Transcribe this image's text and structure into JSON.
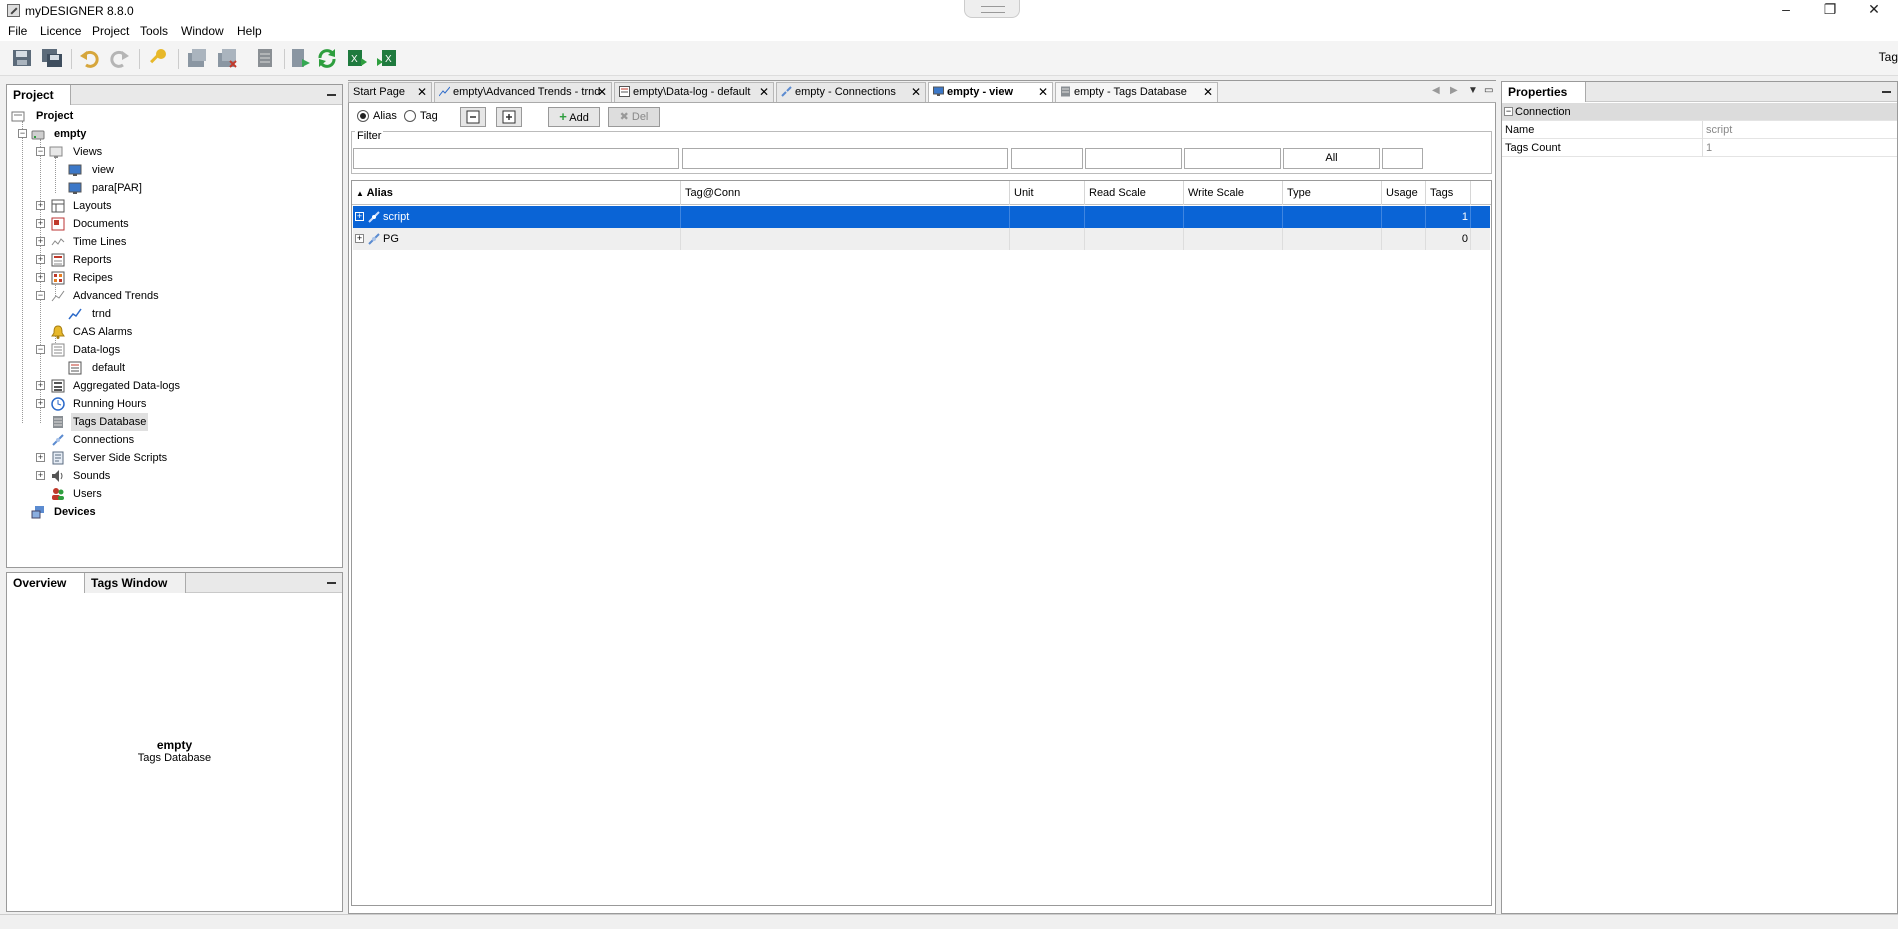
{
  "window": {
    "title": "myDESIGNER 8.8.0",
    "minimize": "–",
    "restore": "❐",
    "close": "✕"
  },
  "menu": [
    "File",
    "Licence",
    "Project",
    "Tools",
    "Window",
    "Help"
  ],
  "toolbar": {
    "right_label": "Tag"
  },
  "project_panel": {
    "title": "Project",
    "tree": [
      {
        "label": "Project",
        "icon": "project-icon",
        "bold": true
      },
      {
        "label": "empty",
        "icon": "hdd-icon",
        "bold": true
      },
      {
        "label": "Views",
        "icon": "views-icon"
      },
      {
        "label": "view",
        "icon": "monitor-icon"
      },
      {
        "label": "para[PAR]",
        "icon": "monitor-icon"
      },
      {
        "label": "Layouts",
        "icon": "layouts-icon"
      },
      {
        "label": "Documents",
        "icon": "documents-icon"
      },
      {
        "label": "Time Lines",
        "icon": "timeline-icon"
      },
      {
        "label": "Reports",
        "icon": "reports-icon"
      },
      {
        "label": "Recipes",
        "icon": "recipes-icon"
      },
      {
        "label": "Advanced Trends",
        "icon": "trend-icon"
      },
      {
        "label": "trnd",
        "icon": "trend-icon"
      },
      {
        "label": "CAS Alarms",
        "icon": "bell-icon"
      },
      {
        "label": "Data-logs",
        "icon": "datalog-icon"
      },
      {
        "label": "default",
        "icon": "datalog-icon"
      },
      {
        "label": "Aggregated Data-logs",
        "icon": "aggregated-icon"
      },
      {
        "label": "Running Hours",
        "icon": "clock-icon"
      },
      {
        "label": "Tags Database",
        "icon": "database-icon"
      },
      {
        "label": "Connections",
        "icon": "connection-icon"
      },
      {
        "label": "Server Side Scripts",
        "icon": "script-icon"
      },
      {
        "label": "Sounds",
        "icon": "speaker-icon"
      },
      {
        "label": "Users",
        "icon": "users-icon"
      },
      {
        "label": "Devices",
        "icon": "devices-icon",
        "bold": true
      }
    ]
  },
  "overview_panel": {
    "tabs": [
      "Overview",
      "Tags Window"
    ],
    "name": "empty",
    "subtitle": "Tags Database"
  },
  "doc_tabs": [
    {
      "label": "Start Page"
    },
    {
      "label": "empty\\Advanced Trends - trnd"
    },
    {
      "label": "empty\\Data-log - default"
    },
    {
      "label": "empty - Connections"
    },
    {
      "label": "empty - view"
    },
    {
      "label": "empty - Tags Database"
    }
  ],
  "tags_db": {
    "radio_alias": "Alias",
    "radio_tag": "Tag",
    "add_label": "Add",
    "del_label": "Del",
    "filter_label": "Filter",
    "filter_all": "All",
    "columns": [
      "Alias",
      "Tag@Conn",
      "Unit",
      "Read Scale",
      "Write Scale",
      "Type",
      "Usage",
      "Tags"
    ],
    "rows": [
      {
        "alias": "script",
        "tags": "1"
      },
      {
        "alias": "PG",
        "tags": "0"
      }
    ]
  },
  "properties": {
    "title": "Properties",
    "section": "Connection",
    "rows": [
      {
        "key": "Name",
        "value": "script"
      },
      {
        "key": "Tags Count",
        "value": "1"
      }
    ]
  }
}
